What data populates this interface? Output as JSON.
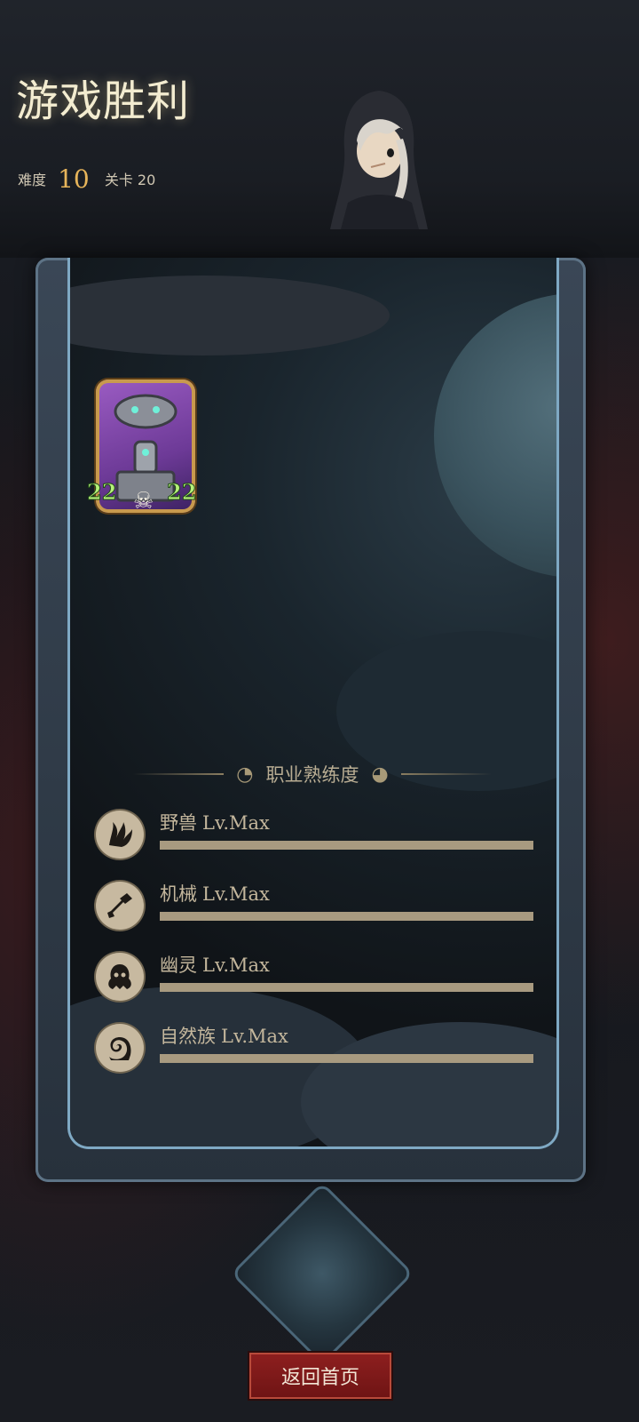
{
  "header": {
    "title": "游戏胜利",
    "difficulty_label": "难度",
    "difficulty_value": "10",
    "stage_label": "关卡 20",
    "avatar_icon": "hooded-character-avatar"
  },
  "reward_card": {
    "attack": "22",
    "health": "22",
    "icon": "robot-minion-card",
    "badge_icon": "skull-icon"
  },
  "proficiency": {
    "title": "职业熟练度",
    "items": [
      {
        "name": "野兽",
        "level": "Lv.Max",
        "progress": 1.0,
        "icon": "beast-claw-icon"
      },
      {
        "name": "机械",
        "level": "Lv.Max",
        "progress": 1.0,
        "icon": "mech-wrench-icon"
      },
      {
        "name": "幽灵",
        "level": "Lv.Max",
        "progress": 1.0,
        "icon": "ghost-icon"
      },
      {
        "name": "自然族",
        "level": "Lv.Max",
        "progress": 1.0,
        "icon": "nature-swirl-icon"
      }
    ]
  },
  "footer": {
    "home_button": "返回首页"
  },
  "colors": {
    "accent_gold": "#e6b45a",
    "button_red": "#8e1f1f",
    "frame_blue": "#7fa9c4"
  }
}
